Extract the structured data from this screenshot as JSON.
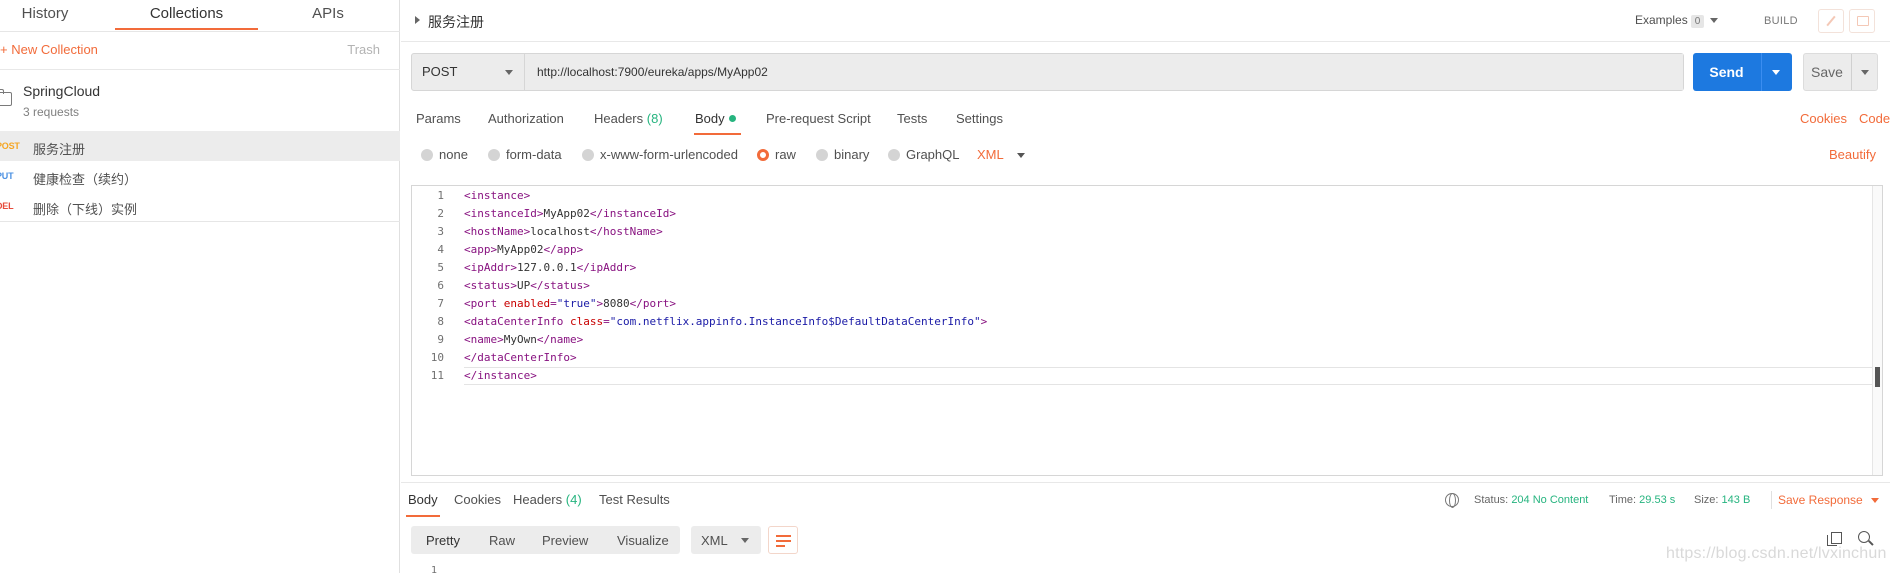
{
  "sidebar": {
    "tabs": [
      {
        "label": "History"
      },
      {
        "label": "Collections",
        "active": true
      },
      {
        "label": "APIs"
      }
    ],
    "new_collection": "+ New Collection",
    "trash": "Trash",
    "collection": {
      "name": "SpringCloud",
      "count": "3 requests",
      "icon": "folder-icon"
    },
    "requests": [
      {
        "method": "POST",
        "name": "服务注册",
        "active": true
      },
      {
        "method": "PUT",
        "name": "健康检查（续约）"
      },
      {
        "method": "DEL",
        "name": "删除（下线）实例"
      }
    ]
  },
  "header": {
    "title": "服务注册",
    "examples_label": "Examples",
    "examples_count": "0",
    "build_label": "BUILD"
  },
  "request": {
    "method": "POST",
    "url": "http://localhost:7900/eureka/apps/MyApp02",
    "send_label": "Send",
    "save_label": "Save",
    "tabs": [
      {
        "label": "Params"
      },
      {
        "label": "Authorization"
      },
      {
        "label": "Headers",
        "count": "(8)"
      },
      {
        "label": "Body",
        "active": true
      },
      {
        "label": "Pre-request Script"
      },
      {
        "label": "Tests"
      },
      {
        "label": "Settings"
      }
    ],
    "cookies_link": "Cookies",
    "code_link": "Code",
    "body_modes": [
      {
        "label": "none"
      },
      {
        "label": "form-data"
      },
      {
        "label": "x-www-form-urlencoded"
      },
      {
        "label": "raw",
        "selected": true
      },
      {
        "label": "binary"
      },
      {
        "label": "GraphQL"
      }
    ],
    "raw_type": "XML",
    "beautify_label": "Beautify"
  },
  "editor": {
    "line_numbers": [
      "1",
      "2",
      "3",
      "4",
      "5",
      "6",
      "7",
      "8",
      "9",
      "10",
      "11"
    ],
    "lines": [
      "<instance>",
      "<instanceId>MyApp02</instanceId>",
      "<hostName>localhost</hostName>",
      "<app>MyApp02</app>",
      "<ipAddr>127.0.0.1</ipAddr>",
      "<status>UP</status>",
      "<port enabled=\"true\">8080</port>",
      "<dataCenterInfo class=\"com.netflix.appinfo.InstanceInfo$DefaultDataCenterInfo\">",
      "<name>MyOwn</name>",
      "</dataCenterInfo>",
      "</instance>"
    ]
  },
  "response": {
    "tabs": [
      {
        "label": "Body",
        "active": true
      },
      {
        "label": "Cookies"
      },
      {
        "label": "Headers",
        "count": "(4)"
      },
      {
        "label": "Test Results"
      }
    ],
    "status_label": "Status:",
    "status_value": "204 No Content",
    "time_label": "Time:",
    "time_value": "29.53 s",
    "size_label": "Size:",
    "size_value": "143 B",
    "save_response": "Save Response",
    "view_modes": [
      "Pretty",
      "Raw",
      "Preview",
      "Visualize"
    ],
    "format": "XML",
    "first_line_number": "1"
  },
  "watermark": "https://blog.csdn.net/lvxinchun",
  "colors": {
    "accent": "#f26b3a",
    "send": "#1d79e0",
    "success": "#26b47f"
  }
}
